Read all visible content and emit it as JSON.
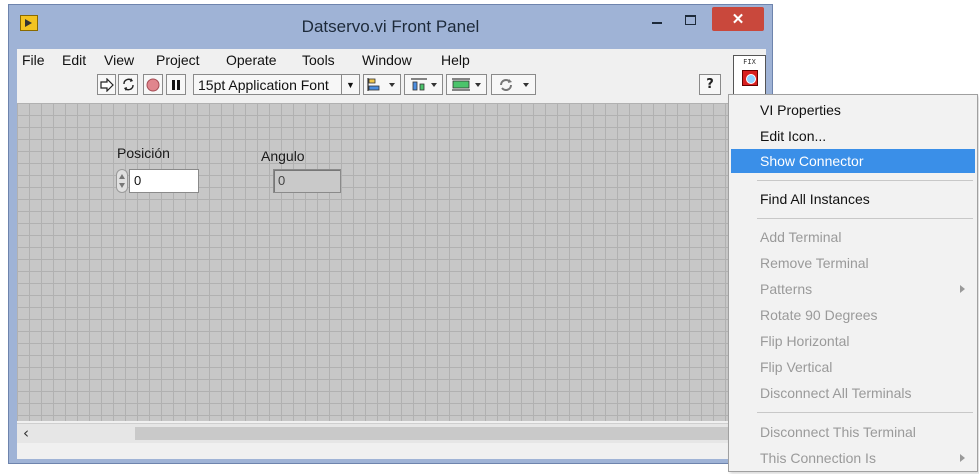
{
  "window": {
    "title": "Datservo.vi Front Panel"
  },
  "menubar": {
    "items": [
      {
        "label": "File"
      },
      {
        "label": "Edit"
      },
      {
        "label": "View"
      },
      {
        "label": "Project"
      },
      {
        "label": "Operate"
      },
      {
        "label": "Tools"
      },
      {
        "label": "Window"
      },
      {
        "label": "Help"
      }
    ]
  },
  "toolbar": {
    "font_label": "15pt Application Font",
    "help_label": "?"
  },
  "vi_icon": {
    "text": "FIX"
  },
  "panel": {
    "posicion": {
      "label": "Posición",
      "value": "0"
    },
    "angulo": {
      "label": "Angulo",
      "value": "0"
    }
  },
  "context_menu": {
    "items": [
      {
        "label": "VI Properties",
        "enabled": true
      },
      {
        "label": "Edit Icon...",
        "enabled": true
      },
      {
        "label": "Show Connector",
        "enabled": true,
        "highlighted": true
      },
      {
        "label": "Find All Instances",
        "enabled": true
      },
      {
        "label": "Add Terminal",
        "enabled": false
      },
      {
        "label": "Remove Terminal",
        "enabled": false
      },
      {
        "label": "Patterns",
        "enabled": false,
        "submenu": true
      },
      {
        "label": "Rotate 90 Degrees",
        "enabled": false
      },
      {
        "label": "Flip Horizontal",
        "enabled": false
      },
      {
        "label": "Flip Vertical",
        "enabled": false
      },
      {
        "label": "Disconnect All Terminals",
        "enabled": false
      },
      {
        "label": "Disconnect This Terminal",
        "enabled": false
      },
      {
        "label": "This Connection Is",
        "enabled": false,
        "submenu": true
      }
    ]
  },
  "colors": {
    "titlebar": "#9fb3d6",
    "close_button": "#c9483c",
    "menu_highlight": "#3a8fe8",
    "panel_grid": "#c7c7c7"
  }
}
